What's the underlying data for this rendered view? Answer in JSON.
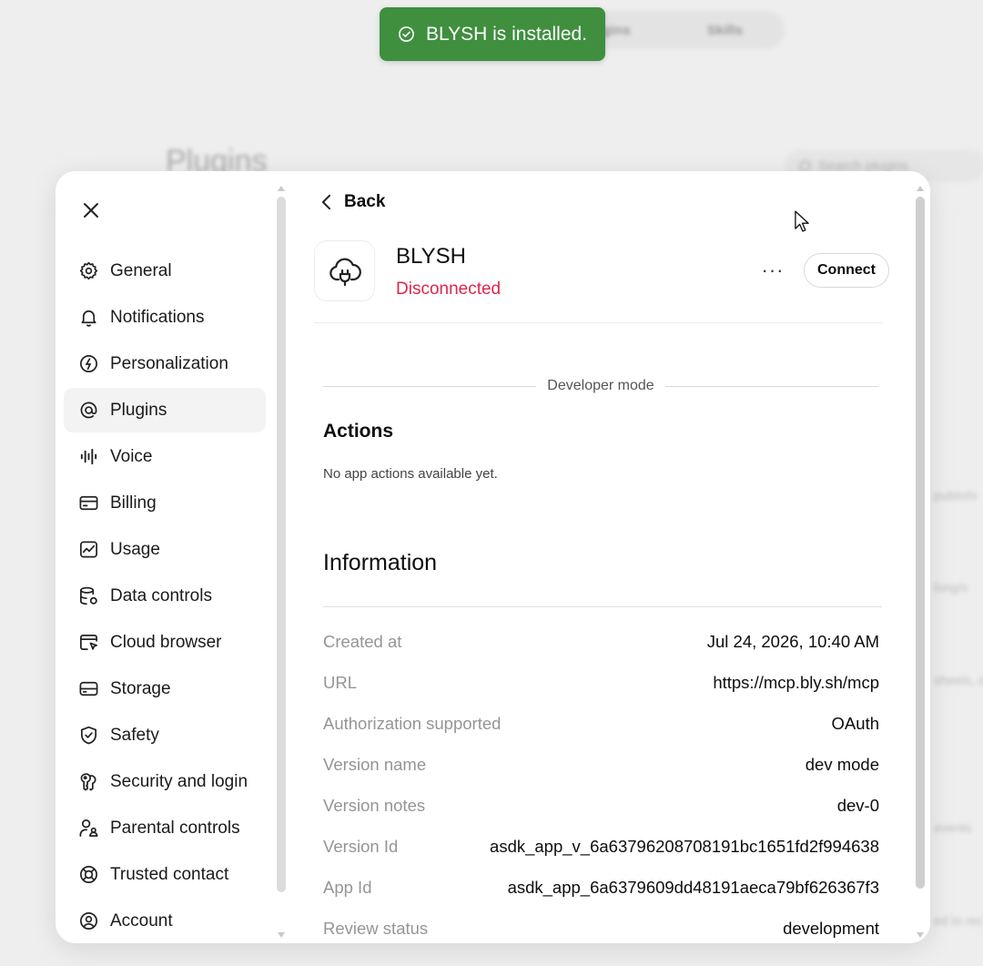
{
  "toast": {
    "icon": "check-circle-icon",
    "message": "BLYSH is installed.",
    "color": "#3f8f3f"
  },
  "background": {
    "tabs": [
      "Plugins",
      "Skills"
    ],
    "title": "Plugins",
    "search_placeholder": "Search plugins",
    "snippets": [
      "publishi",
      "long/s",
      "sheets, d",
      "events",
      "ed to rec"
    ]
  },
  "sidebar": {
    "close_icon": "close-icon",
    "items": [
      {
        "label": "General",
        "icon": "gear-icon",
        "active": false
      },
      {
        "label": "Notifications",
        "icon": "bell-icon",
        "active": false
      },
      {
        "label": "Personalization",
        "icon": "personalization-icon",
        "active": false
      },
      {
        "label": "Plugins",
        "icon": "at-sign-icon",
        "active": true
      },
      {
        "label": "Voice",
        "icon": "waveform-icon",
        "active": false
      },
      {
        "label": "Billing",
        "icon": "credit-card-icon",
        "active": false
      },
      {
        "label": "Usage",
        "icon": "chart-icon",
        "active": false
      },
      {
        "label": "Data controls",
        "icon": "database-icon",
        "active": false
      },
      {
        "label": "Cloud browser",
        "icon": "cloud-browser-icon",
        "active": false
      },
      {
        "label": "Storage",
        "icon": "storage-icon",
        "active": false
      },
      {
        "label": "Safety",
        "icon": "shield-icon",
        "active": false
      },
      {
        "label": "Security and login",
        "icon": "key-icon",
        "active": false
      },
      {
        "label": "Parental controls",
        "icon": "parental-icon",
        "active": false
      },
      {
        "label": "Trusted contact",
        "icon": "lifebuoy-icon",
        "active": false
      },
      {
        "label": "Account",
        "icon": "account-icon",
        "active": false
      }
    ]
  },
  "content": {
    "back_label": "Back",
    "app": {
      "name": "BLYSH",
      "status": "Disconnected",
      "icon": "cloud-plug-icon",
      "status_color": "#e0254e"
    },
    "more_label": "···",
    "connect_label": "Connect",
    "developer_mode_label": "Developer mode",
    "actions_title": "Actions",
    "actions_empty": "No app actions available yet.",
    "information_title": "Information",
    "info": [
      {
        "key": "Created at",
        "value": "Jul 24, 2026, 10:40 AM"
      },
      {
        "key": "URL",
        "value": "https://mcp.bly.sh/mcp"
      },
      {
        "key": "Authorization supported",
        "value": "OAuth"
      },
      {
        "key": "Version name",
        "value": "dev mode"
      },
      {
        "key": "Version notes",
        "value": "dev-0"
      },
      {
        "key": "Version Id",
        "value": "asdk_app_v_6a63796208708191bc1651fd2f994638"
      },
      {
        "key": "App Id",
        "value": "asdk_app_6a6379609dd48191aeca79bf626367f3"
      },
      {
        "key": "Review status",
        "value": "development"
      }
    ]
  }
}
